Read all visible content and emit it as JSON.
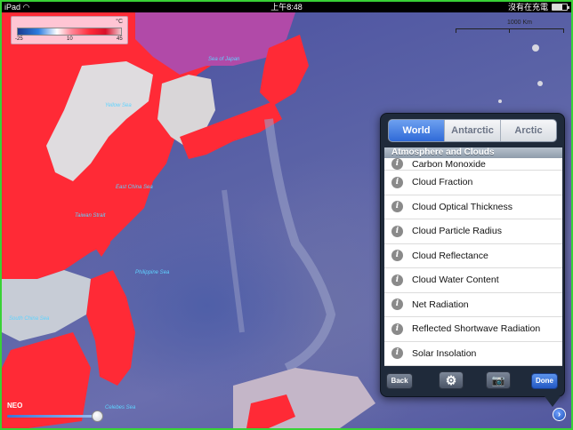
{
  "status_bar": {
    "device": "iPad",
    "time": "上午8:48",
    "right_text": "沒有在充電"
  },
  "legend": {
    "unit": "°C",
    "ticks": [
      "-25",
      "10",
      "45"
    ]
  },
  "scale": {
    "label": "1000 Km"
  },
  "ocean_labels": [
    "Sea of Japan",
    "Yellow Sea",
    "East China Sea",
    "Taiwan Strait",
    "Philippine Sea",
    "South China Sea",
    "Celebes Sea"
  ],
  "popover": {
    "tabs": [
      {
        "label": "World",
        "active": true
      },
      {
        "label": "Antarctic"
      },
      {
        "label": "Arctic"
      }
    ],
    "section": "Atmosphere and Clouds",
    "items": [
      "Carbon Monoxide",
      "Cloud Fraction",
      "Cloud Optical Thickness",
      "Cloud Particle Radius",
      "Cloud Reflectance",
      "Cloud Water Content",
      "Net Radiation",
      "Reflected Shortwave Radiation",
      "Solar Insolation"
    ],
    "toolbar": {
      "back": "Back",
      "done": "Done"
    }
  },
  "neo": {
    "label": "NEO"
  },
  "colors": {
    "frame": "#39d236",
    "accent": "#2f6ad8",
    "land_hot": "#ff2230",
    "ocean": "#5a62a6"
  },
  "icons": [
    "wifi-icon",
    "battery-icon",
    "info-icon",
    "gear-icon",
    "camera-icon",
    "disclosure-icon"
  ]
}
